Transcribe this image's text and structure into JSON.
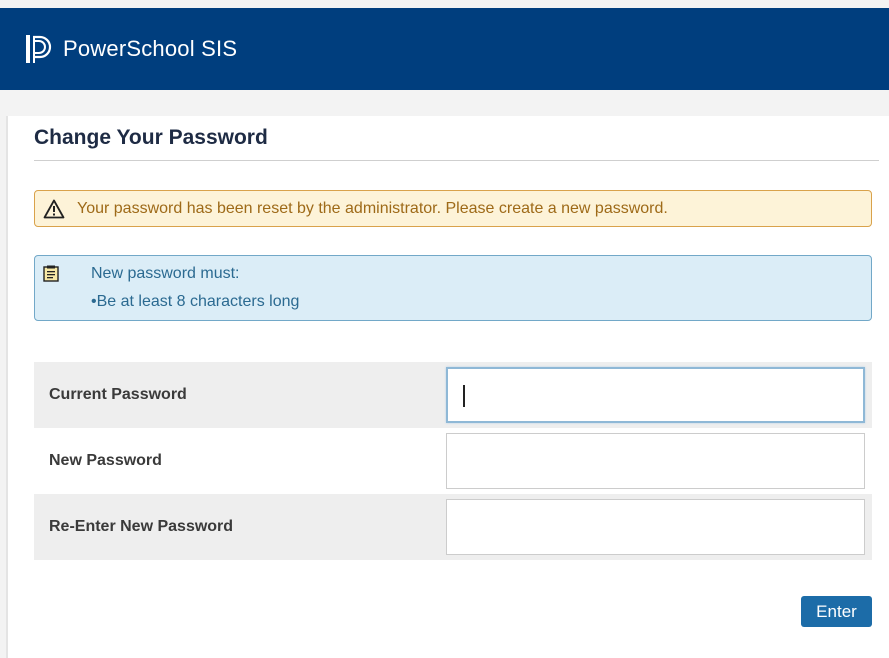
{
  "header": {
    "brand": "PowerSchool SIS",
    "logo_icon": "powerschool-logo-icon",
    "bg_color": "#003e7e"
  },
  "page": {
    "title": "Change Your Password"
  },
  "alerts": {
    "warning_icon": "warning-triangle-icon",
    "warning_text": "Your password has been reset by the administrator. Please create a new password.",
    "info_icon": "notepad-icon",
    "info_line1": "New password must:",
    "info_line2": "•Be at least 8 characters long"
  },
  "form": {
    "fields": [
      {
        "label": "Current Password",
        "value": "",
        "focused": true
      },
      {
        "label": "New Password",
        "value": "",
        "focused": false
      },
      {
        "label": "Re-Enter New Password",
        "value": "",
        "focused": false
      }
    ],
    "submit_label": "Enter"
  },
  "colors": {
    "accent": "#1c6ca8",
    "warning_bg": "#fdf3d8",
    "info_bg": "#dbedf7"
  }
}
